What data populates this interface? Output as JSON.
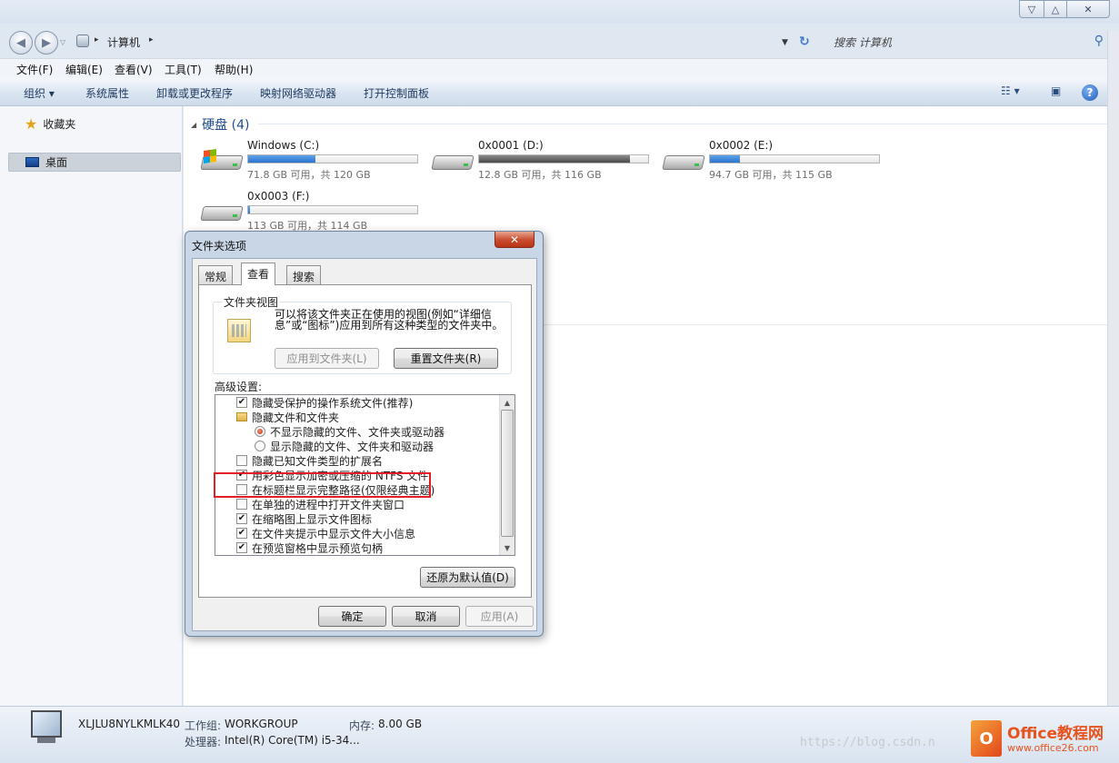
{
  "window": {
    "controls": {
      "min": "▽",
      "max": "△",
      "close": "✕"
    }
  },
  "address": {
    "crumb": "计算机",
    "search_placeholder": "搜索 计算机"
  },
  "menu": [
    "文件(F)",
    "编辑(E)",
    "查看(V)",
    "工具(T)",
    "帮助(H)"
  ],
  "commands": {
    "organize": "组织 ▾",
    "system_properties": "系统属性",
    "uninstall": "卸载或更改程序",
    "map_drive": "映射网络驱动器",
    "control_panel": "打开控制面板",
    "help": "?"
  },
  "nav": {
    "favorites": "收藏夹",
    "desktop": "桌面"
  },
  "section": {
    "title": "硬盘 (4)"
  },
  "drives": [
    {
      "name": "Windows (C:)",
      "free": "71.8 GB 可用，共 120 GB",
      "used_fraction": 0.4
    },
    {
      "name": "0x0001 (D:)",
      "free": "12.8 GB 可用，共 116 GB",
      "used_fraction": 0.89
    },
    {
      "name": "0x0002 (E:)",
      "free": "94.7 GB 可用，共 115 GB",
      "used_fraction": 0.18
    },
    {
      "name": "0x0003 (F:)",
      "free": "113 GB 可用，共 114 GB",
      "used_fraction": 0.01
    }
  ],
  "details": {
    "computer_name": "XLJLU8NYLKMLK40",
    "workgroup_label": "工作组:",
    "workgroup_value": "WORKGROUP",
    "memory_label": "内存:",
    "memory_value": "8.00 GB",
    "cpu_label": "处理器:",
    "cpu_value": "Intel(R) Core(TM) i5-34..."
  },
  "watermark": "https://blog.csdn.n",
  "logo": {
    "badge": "O",
    "title": "Office教程网",
    "url": "www.office26.com"
  },
  "dialog": {
    "title": "文件夹选项",
    "close": "✕",
    "tabs": [
      "常规",
      "查看",
      "搜索"
    ],
    "folder_view_group": "文件夹视图",
    "folder_view_text": "可以将该文件夹正在使用的视图(例如“详细信息”或“图标”)应用到所有这种类型的文件夹中。",
    "apply_to_folders": "应用到文件夹(L)",
    "reset_folders": "重置文件夹(R)",
    "advanced_label": "高级设置:",
    "advanced_items": [
      {
        "type": "checkbox",
        "checked": true,
        "label": "隐藏受保护的操作系统文件(推荐)"
      },
      {
        "type": "folder",
        "label": "隐藏文件和文件夹"
      },
      {
        "type": "radio",
        "checked": true,
        "label": "不显示隐藏的文件、文件夹或驱动器"
      },
      {
        "type": "radio",
        "checked": false,
        "label": "显示隐藏的文件、文件夹和驱动器"
      },
      {
        "type": "checkbox",
        "checked": false,
        "label": "隐藏已知文件类型的扩展名"
      },
      {
        "type": "checkbox",
        "checked": true,
        "label": "用彩色显示加密或压缩的 NTFS 文件"
      },
      {
        "type": "checkbox",
        "checked": false,
        "label": "在标题栏显示完整路径(仅限经典主题)"
      },
      {
        "type": "checkbox",
        "checked": false,
        "label": "在单独的进程中打开文件夹窗口"
      },
      {
        "type": "checkbox",
        "checked": true,
        "label": "在缩略图上显示文件图标"
      },
      {
        "type": "checkbox",
        "checked": true,
        "label": "在文件夹提示中显示文件大小信息"
      },
      {
        "type": "checkbox",
        "checked": true,
        "label": "在预览窗格中显示预览句柄"
      }
    ],
    "restore_defaults": "还原为默认值(D)",
    "ok": "确定",
    "cancel": "取消",
    "apply": "应用(A)"
  },
  "colors": {
    "accent": "#1e4d8c",
    "highlight_box": "#e21d25",
    "drive_fill": "#2a73cf"
  }
}
